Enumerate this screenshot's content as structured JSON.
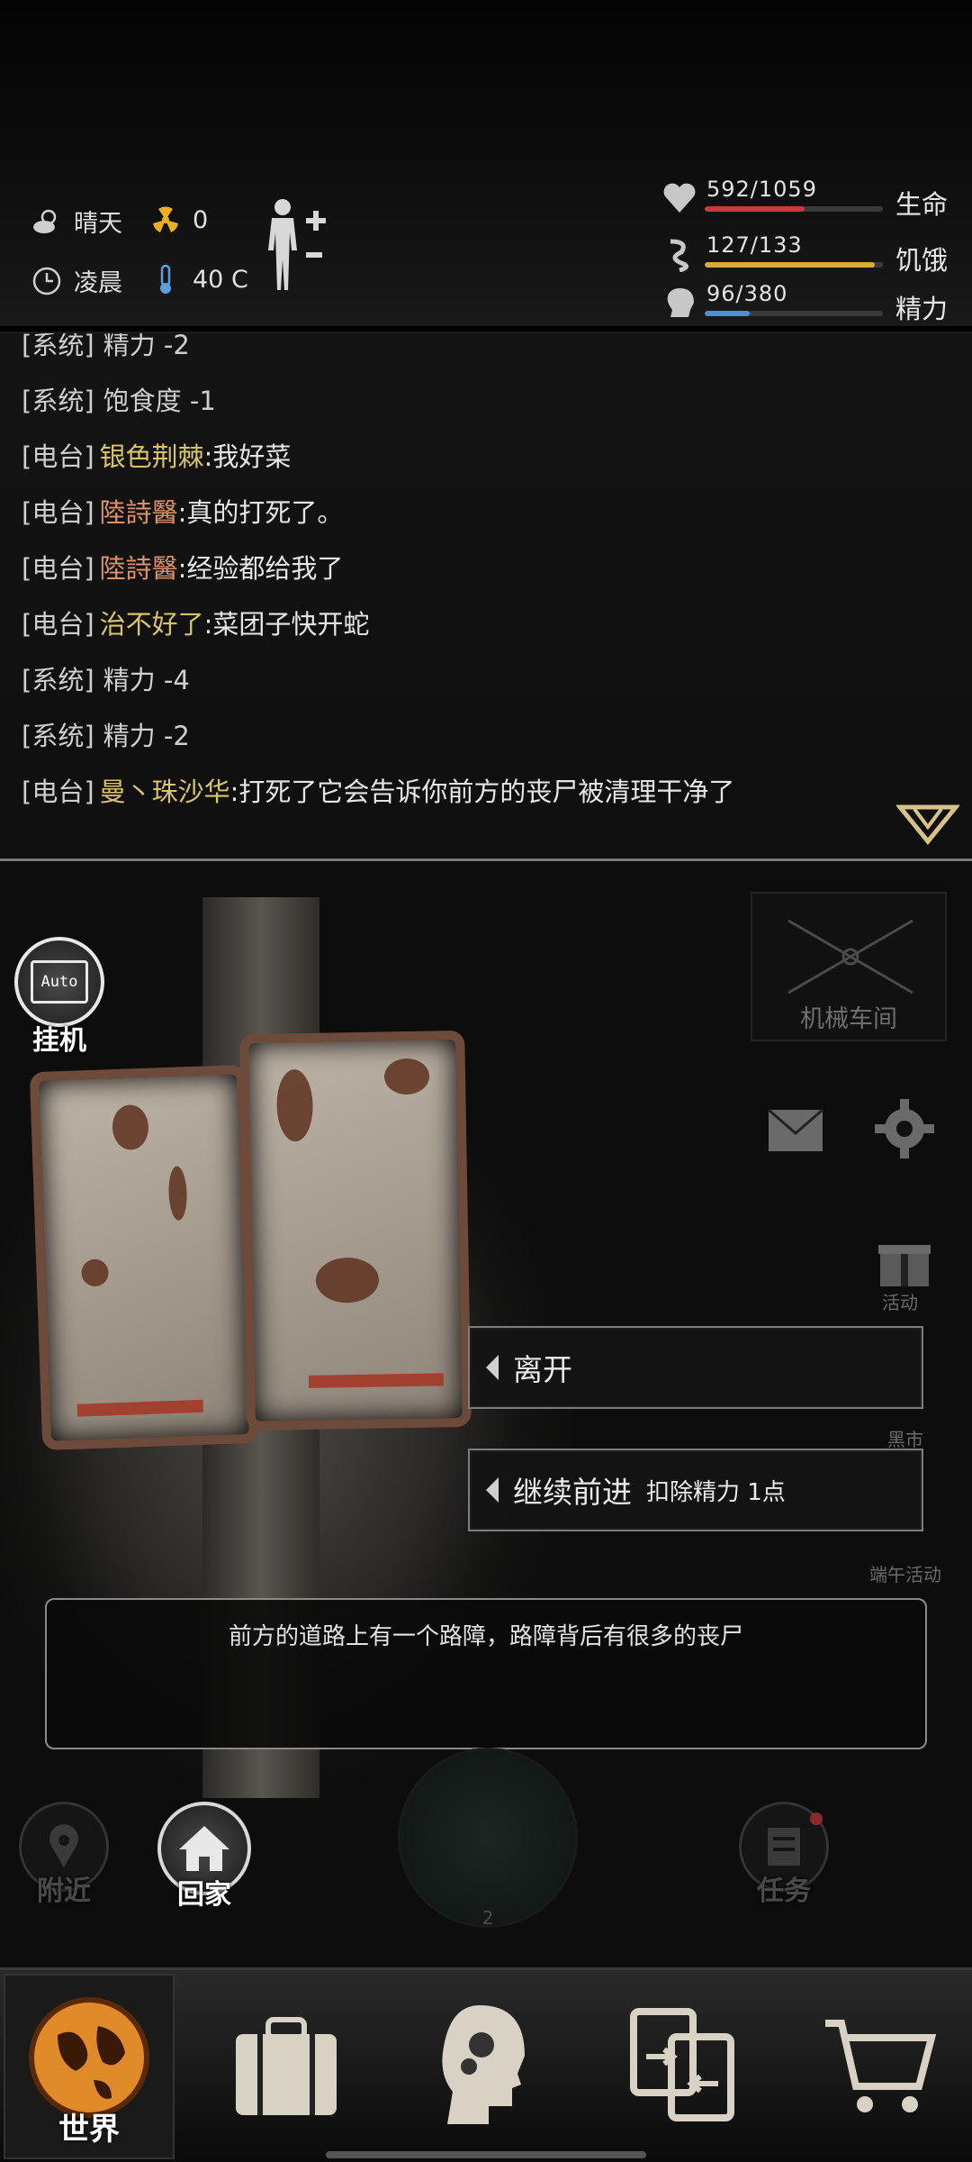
{
  "hud": {
    "weather": "晴天",
    "radiation": "0",
    "time_of_day": "凌晨",
    "temperature": "40 C",
    "icons": [
      "sun-cloud-icon",
      "radiation-icon",
      "clock-icon",
      "thermometer-icon",
      "body-status-icon"
    ],
    "bars": [
      {
        "value": "592/1059",
        "label": "生命",
        "icon": "heart-icon",
        "fraction": 0.559,
        "color": "#c93a3a"
      },
      {
        "value": "127/133",
        "label": "饥饿",
        "icon": "stomach-icon",
        "fraction": 0.955,
        "color": "#d9a93a"
      },
      {
        "value": "96/380",
        "label": "精力",
        "icon": "head-icon",
        "fraction": 0.253,
        "color": "#4a90d9"
      }
    ]
  },
  "log": [
    {
      "tag": "[系统]",
      "name": "",
      "text": "精力 -2",
      "name_color": ""
    },
    {
      "tag": "[系统]",
      "name": "",
      "text": "饱食度 -1",
      "name_color": ""
    },
    {
      "tag": "[电台]",
      "name": "银色荆棘",
      "text": ":我好菜",
      "name_color": "yellow"
    },
    {
      "tag": "[电台]",
      "name": "陸詩醫",
      "text": ":真的打死了。",
      "name_color": "orange"
    },
    {
      "tag": "[电台]",
      "name": "陸詩醫",
      "text": ":经验都给我了",
      "name_color": "orange"
    },
    {
      "tag": "[电台]",
      "name": "治不好了",
      "text": ":菜团子快开蛇",
      "name_color": "yellow"
    },
    {
      "tag": "[系统]",
      "name": "",
      "text": "精力 -4",
      "name_color": ""
    },
    {
      "tag": "[系统]",
      "name": "",
      "text": "精力 -2",
      "name_color": ""
    },
    {
      "tag": "[电台]",
      "name": "曼丶珠沙华",
      "text": ":打死了它会告诉你前方的丧尸被清理干净了",
      "name_color": "yellow"
    }
  ],
  "scene": {
    "auto_label": "挂机",
    "auto_icon_text": "Auto",
    "workshop_label": "机械车间",
    "side_labels": {
      "activity": "活动",
      "black_market": "黑市",
      "festival": "端午活动"
    },
    "choices": [
      {
        "label": "离开",
        "sub": ""
      },
      {
        "label": "继续前进",
        "sub": "扣除精力 1点"
      }
    ],
    "description": "前方的道路上有一个路障，路障背后有很多的丧尸",
    "nearby_label": "附近",
    "home_label": "回家",
    "task_label": "任务",
    "radar_label": "2"
  },
  "nav": {
    "world_label": "世界",
    "icons": [
      "globe-icon",
      "suitcase-icon",
      "brain-icon",
      "trade-icon",
      "cart-icon"
    ]
  }
}
